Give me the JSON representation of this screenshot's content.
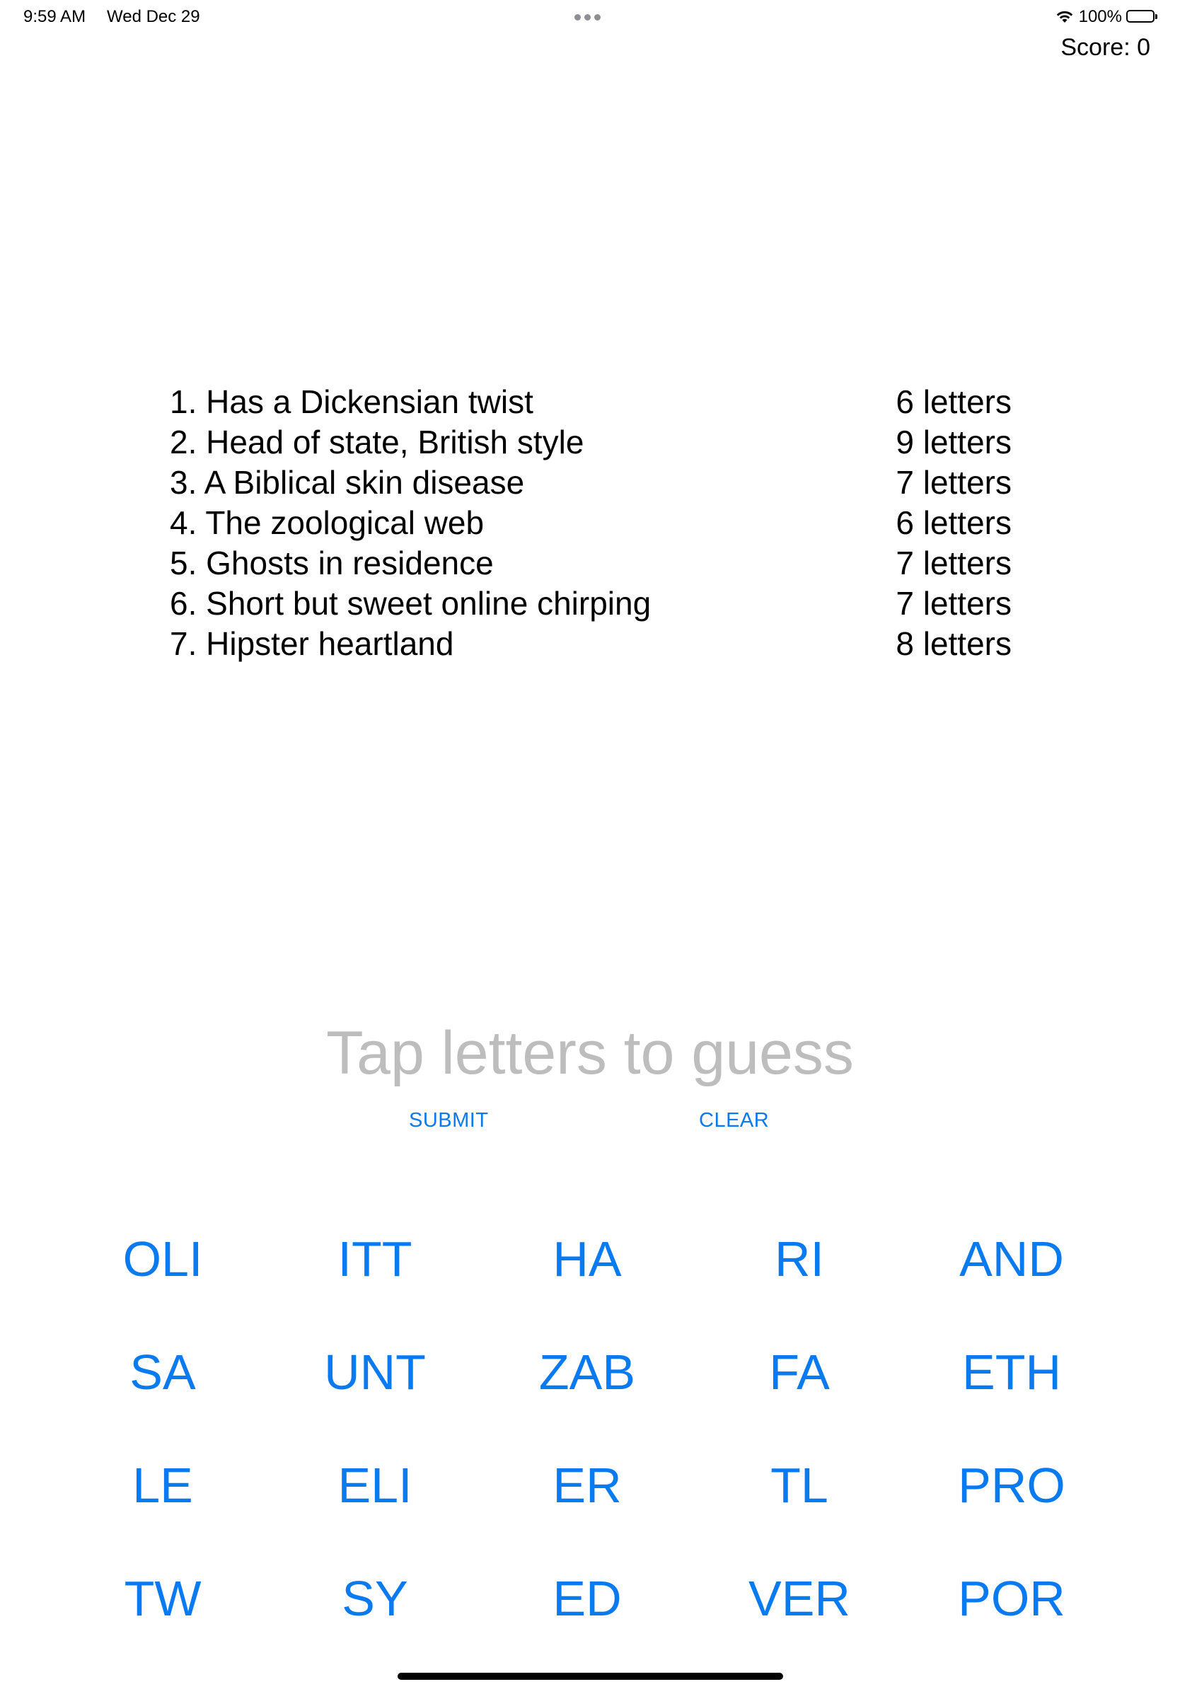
{
  "status_bar": {
    "time": "9:59 AM",
    "date": "Wed Dec 29",
    "battery": "100%"
  },
  "header": {
    "score": "Score: 0"
  },
  "clues": [
    {
      "text": "1. Has a Dickensian twist",
      "length": "6 letters"
    },
    {
      "text": "2. Head of state, British style",
      "length": "9 letters"
    },
    {
      "text": "3. A Biblical skin disease",
      "length": "7 letters"
    },
    {
      "text": "4. The zoological web",
      "length": "6 letters"
    },
    {
      "text": "5. Ghosts in residence",
      "length": "7 letters"
    },
    {
      "text": "6. Short but sweet online chirping",
      "length": "7 letters"
    },
    {
      "text": "7. Hipster heartland",
      "length": "8 letters"
    }
  ],
  "guess": {
    "placeholder": "Tap letters to guess"
  },
  "actions": {
    "submit_label": "SUBMIT",
    "clear_label": "CLEAR"
  },
  "tiles": [
    "OLI",
    "ITT",
    "HA",
    "RI",
    "AND",
    "SA",
    "UNT",
    "ZAB",
    "FA",
    "ETH",
    "LE",
    "ELI",
    "ER",
    "TL",
    "PRO",
    "TW",
    "SY",
    "ED",
    "VER",
    "POR"
  ],
  "colors": {
    "accent": "#0a7af0",
    "placeholder": "#bdbdbd"
  },
  "icons": {
    "wifi": "wifi-icon",
    "battery": "battery-icon",
    "multitask": "multitasking-dots-icon"
  }
}
